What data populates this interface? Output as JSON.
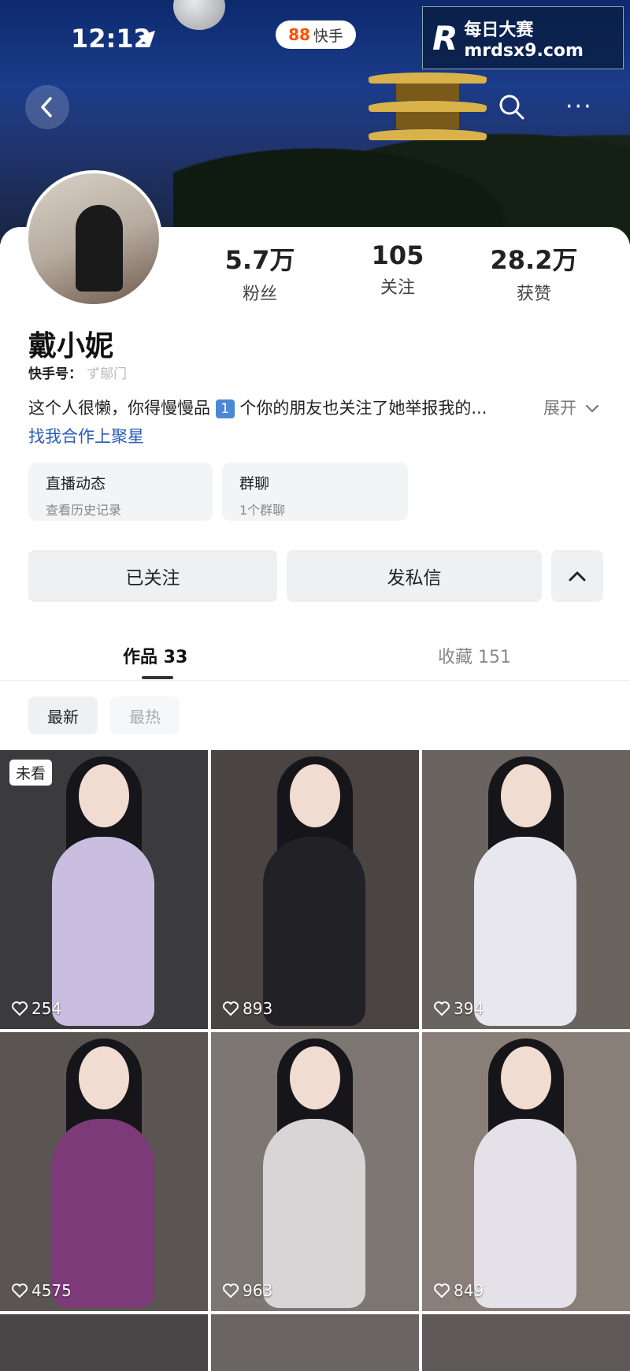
{
  "status_bar": {
    "time": "12:12"
  },
  "app_badge": {
    "logo": "88",
    "name": "快手"
  },
  "watermark": {
    "brand": "R",
    "line1": "每日大赛",
    "line2": "mrdsx9.com"
  },
  "header": {
    "back_icon": "chevron-left-icon",
    "search_icon": "search-icon",
    "more_label": "···"
  },
  "profile": {
    "name": "戴小妮",
    "kuaishou_id_label": "快手号：",
    "kuaishou_id_value": "ず鄔门",
    "stats": [
      {
        "value": "5.7万",
        "label": "粉丝"
      },
      {
        "value": "105",
        "label": "关注"
      },
      {
        "value": "28.2万",
        "label": "获赞"
      }
    ],
    "bio_prefix": "这个人很懒，你得慢慢品",
    "bio_badge": "1",
    "bio_suffix": "个你的朋友也关注了她举报我的...",
    "expand_label": "展开",
    "biz_link": "找我合作上聚星"
  },
  "cards": [
    {
      "title": "直播动态",
      "subtitle": "查看历史记录"
    },
    {
      "title": "群聊",
      "subtitle": "1个群聊"
    }
  ],
  "actions": {
    "follow": "已关注",
    "message": "发私信",
    "collapse_icon": "chevron-up-icon"
  },
  "tabs": [
    {
      "label": "作品 33",
      "active": true
    },
    {
      "label": "收藏 151",
      "active": false
    }
  ],
  "sort": [
    {
      "label": "最新",
      "active": true
    },
    {
      "label": "最热",
      "active": false
    }
  ],
  "posts": [
    {
      "likes": "254",
      "unseen": "未看",
      "bg": "#3b3a3d",
      "outfit": "#c9bde0"
    },
    {
      "likes": "893",
      "bg": "#4a4442",
      "outfit": "#222226"
    },
    {
      "likes": "394",
      "bg": "#6a6460",
      "outfit": "#e8e6ee"
    },
    {
      "likes": "4575",
      "bg": "#5a5552",
      "outfit": "#7d3a78"
    },
    {
      "likes": "963",
      "bg": "#7c7772",
      "outfit": "#d9d4d6"
    },
    {
      "likes": "849",
      "bg": "#8a7f78",
      "outfit": "#e4e2e8"
    }
  ]
}
